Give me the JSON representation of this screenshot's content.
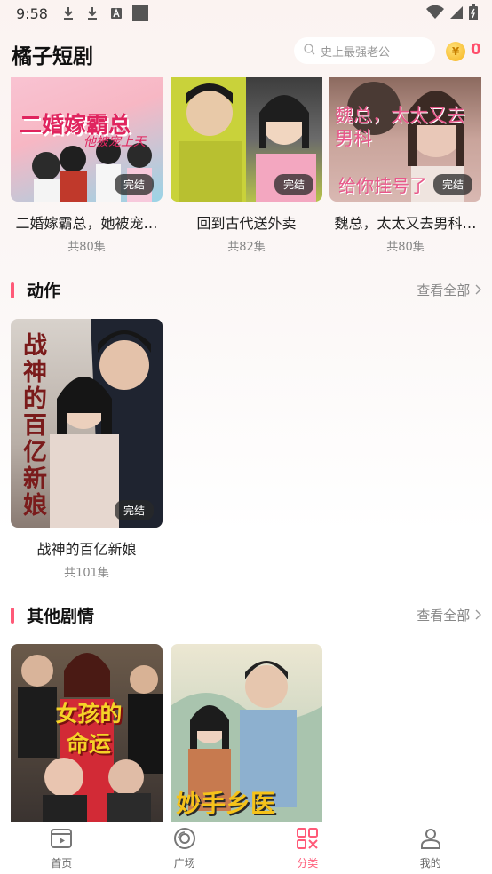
{
  "status": {
    "time": "9:58"
  },
  "app": {
    "title": "橘子短剧",
    "search_placeholder": "史上最强老公",
    "coin_count": "0",
    "coin_symbol": "¥"
  },
  "top_row": [
    {
      "title": "二婚嫁霸总，她被宠…",
      "episodes": "共80集",
      "badge": "完结",
      "poster_text": "二婚嫁霸总",
      "poster_text2": "他被宠上天"
    },
    {
      "title": "回到古代送外卖",
      "episodes": "共82集",
      "badge": "完结"
    },
    {
      "title": "魏总，太太又去男科…",
      "episodes": "共80集",
      "badge": "完结",
      "poster_text": "魏总，太太又去男科",
      "poster_text2": "给你挂号了"
    }
  ],
  "section_action": {
    "title": "动作",
    "more": "查看全部"
  },
  "action_items": [
    {
      "title": "战神的百亿新娘",
      "episodes": "共101集",
      "badge": "完结",
      "poster_text": "战神的百亿新娘"
    }
  ],
  "section_other": {
    "title": "其他剧情",
    "more": "查看全部"
  },
  "other_items": [
    {
      "poster_text": "女孩的命运"
    },
    {
      "poster_text": "妙手乡医"
    }
  ],
  "tabs": [
    {
      "label": "首页",
      "icon": "home-video-icon",
      "active": false
    },
    {
      "label": "广场",
      "icon": "disc-icon",
      "active": false
    },
    {
      "label": "分类",
      "icon": "category-grid-icon",
      "active": true
    },
    {
      "label": "我的",
      "icon": "profile-icon",
      "active": false
    }
  ],
  "colors": {
    "accent": "#ff5a78",
    "coin": "#f6b21c"
  }
}
